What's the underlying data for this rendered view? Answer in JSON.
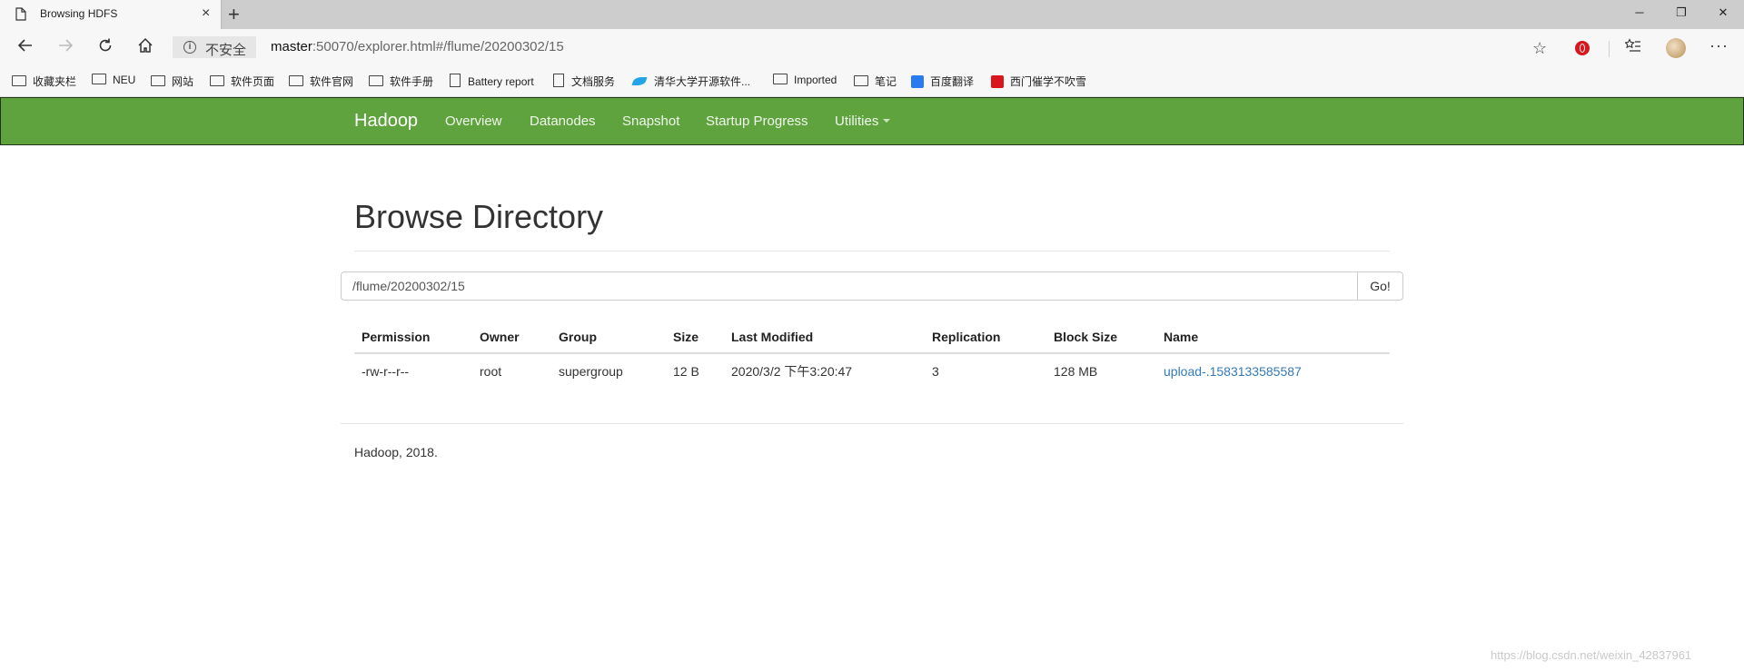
{
  "browser": {
    "tab_title": "Browsing HDFS",
    "tab_close": "×",
    "new_tab": "+",
    "win_min": "─",
    "win_restore": "❐",
    "win_close": "✕",
    "insecure_label": "不安全",
    "url_host": "master",
    "url_rest": ":50070/explorer.html#/flume/20200302/15"
  },
  "bookmarks": [
    {
      "label": "收藏夹栏",
      "icon": "folder-icon"
    },
    {
      "label": "NEU",
      "icon": "folder-icon"
    },
    {
      "label": "网站",
      "icon": "folder-icon"
    },
    {
      "label": "软件页面",
      "icon": "folder-icon"
    },
    {
      "label": "软件官网",
      "icon": "folder-icon"
    },
    {
      "label": "软件手册",
      "icon": "folder-icon"
    },
    {
      "label": "Battery report",
      "icon": "page-icon"
    },
    {
      "label": "文档服务",
      "icon": "page-icon"
    },
    {
      "label": "清华大学开源软件...",
      "icon": "tuna-icon"
    },
    {
      "label": "Imported",
      "icon": "folder-icon"
    },
    {
      "label": "笔记",
      "icon": "folder-icon"
    },
    {
      "label": "百度翻译",
      "icon": "baidu-translate-icon"
    },
    {
      "label": "西门催学不吹雪",
      "icon": "csdn-icon"
    }
  ],
  "hadoop_nav": {
    "brand": "Hadoop",
    "links": [
      "Overview",
      "Datanodes",
      "Snapshot",
      "Startup Progress",
      "Utilities"
    ]
  },
  "main": {
    "title": "Browse Directory",
    "path_value": "/flume/20200302/15",
    "go_label": "Go!",
    "columns": [
      "Permission",
      "Owner",
      "Group",
      "Size",
      "Last Modified",
      "Replication",
      "Block Size",
      "Name"
    ],
    "rows": [
      [
        "-rw-r--r--",
        "root",
        "supergroup",
        "12 B",
        "2020/3/2 下午3:20:47",
        "3",
        "128 MB",
        "upload-.1583133585587"
      ]
    ]
  },
  "footer": "Hadoop, 2018.",
  "watermark": "https://blog.csdn.net/weixin_42837961",
  "colors": {
    "navbar_green": "#5fa33e",
    "link_blue": "#337ab7",
    "tuna_blue": "#23a4e6",
    "baidu_blue": "#2b7bf0",
    "csdn_red": "#d9161c"
  }
}
